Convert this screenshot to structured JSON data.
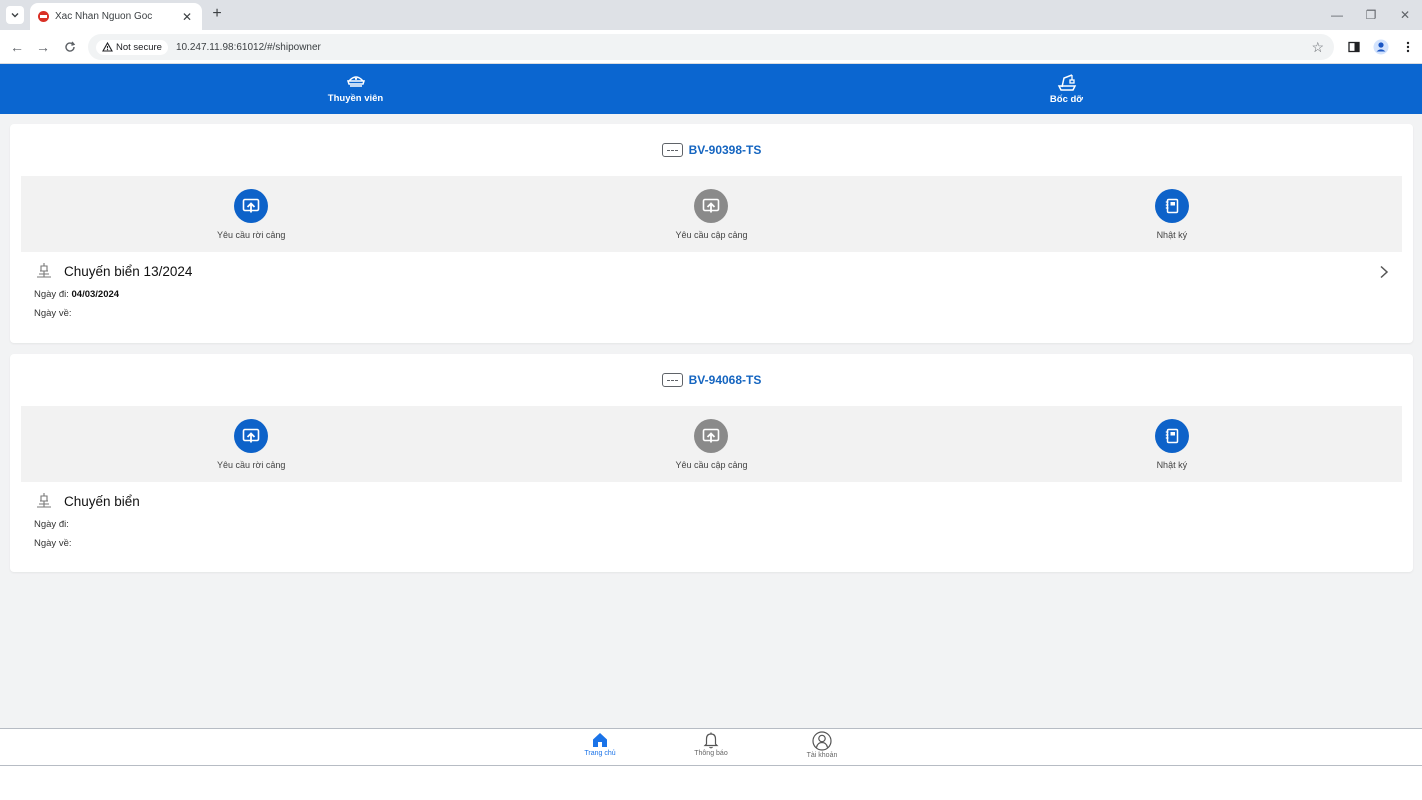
{
  "browser": {
    "tab_title": "Xac Nhan Nguon Goc",
    "security_label": "Not secure",
    "url": "10.247.11.98:61012/#/shipowner"
  },
  "topnav": {
    "items": [
      {
        "label": "Thuyền viên",
        "icon": "ship-captain-hat-icon"
      },
      {
        "label": "Bốc dỡ",
        "icon": "crane-icon"
      }
    ]
  },
  "cards": [
    {
      "plate": "BV-90398-TS",
      "actions": [
        {
          "label": "Yêu cầu rời cảng",
          "icon": "upload-screen-icon",
          "color": "#0d62c9"
        },
        {
          "label": "Yêu cầu cập cảng",
          "icon": "upload-screen-icon",
          "color": "#8a8a8a"
        },
        {
          "label": "Nhật ký",
          "icon": "logbook-icon",
          "color": "#0d62c9"
        }
      ],
      "trip_title": "Chuyến biển 13/2024",
      "depart_label": "Ngày đi:",
      "depart_value": "04/03/2024",
      "return_label": "Ngày về:",
      "return_value": ""
    },
    {
      "plate": "BV-94068-TS",
      "actions": [
        {
          "label": "Yêu cầu rời cảng",
          "icon": "upload-screen-icon",
          "color": "#0d62c9"
        },
        {
          "label": "Yêu cầu cập cảng",
          "icon": "upload-screen-icon",
          "color": "#8a8a8a"
        },
        {
          "label": "Nhật ký",
          "icon": "logbook-icon",
          "color": "#0d62c9"
        }
      ],
      "trip_title": "Chuyến biển",
      "depart_label": "Ngày đi:",
      "depart_value": "",
      "return_label": "Ngày về:",
      "return_value": ""
    }
  ],
  "bottomnav": {
    "items": [
      {
        "label": "Trang chủ",
        "icon": "home-icon",
        "active": true
      },
      {
        "label": "Thông báo",
        "icon": "bell-icon",
        "active": false
      },
      {
        "label": "Tài khoản",
        "icon": "user-circle-icon",
        "active": false
      }
    ]
  },
  "colors": {
    "primary": "#0b66d0",
    "plate_text": "#1565c0",
    "disabled_action": "#8a8a8a"
  }
}
